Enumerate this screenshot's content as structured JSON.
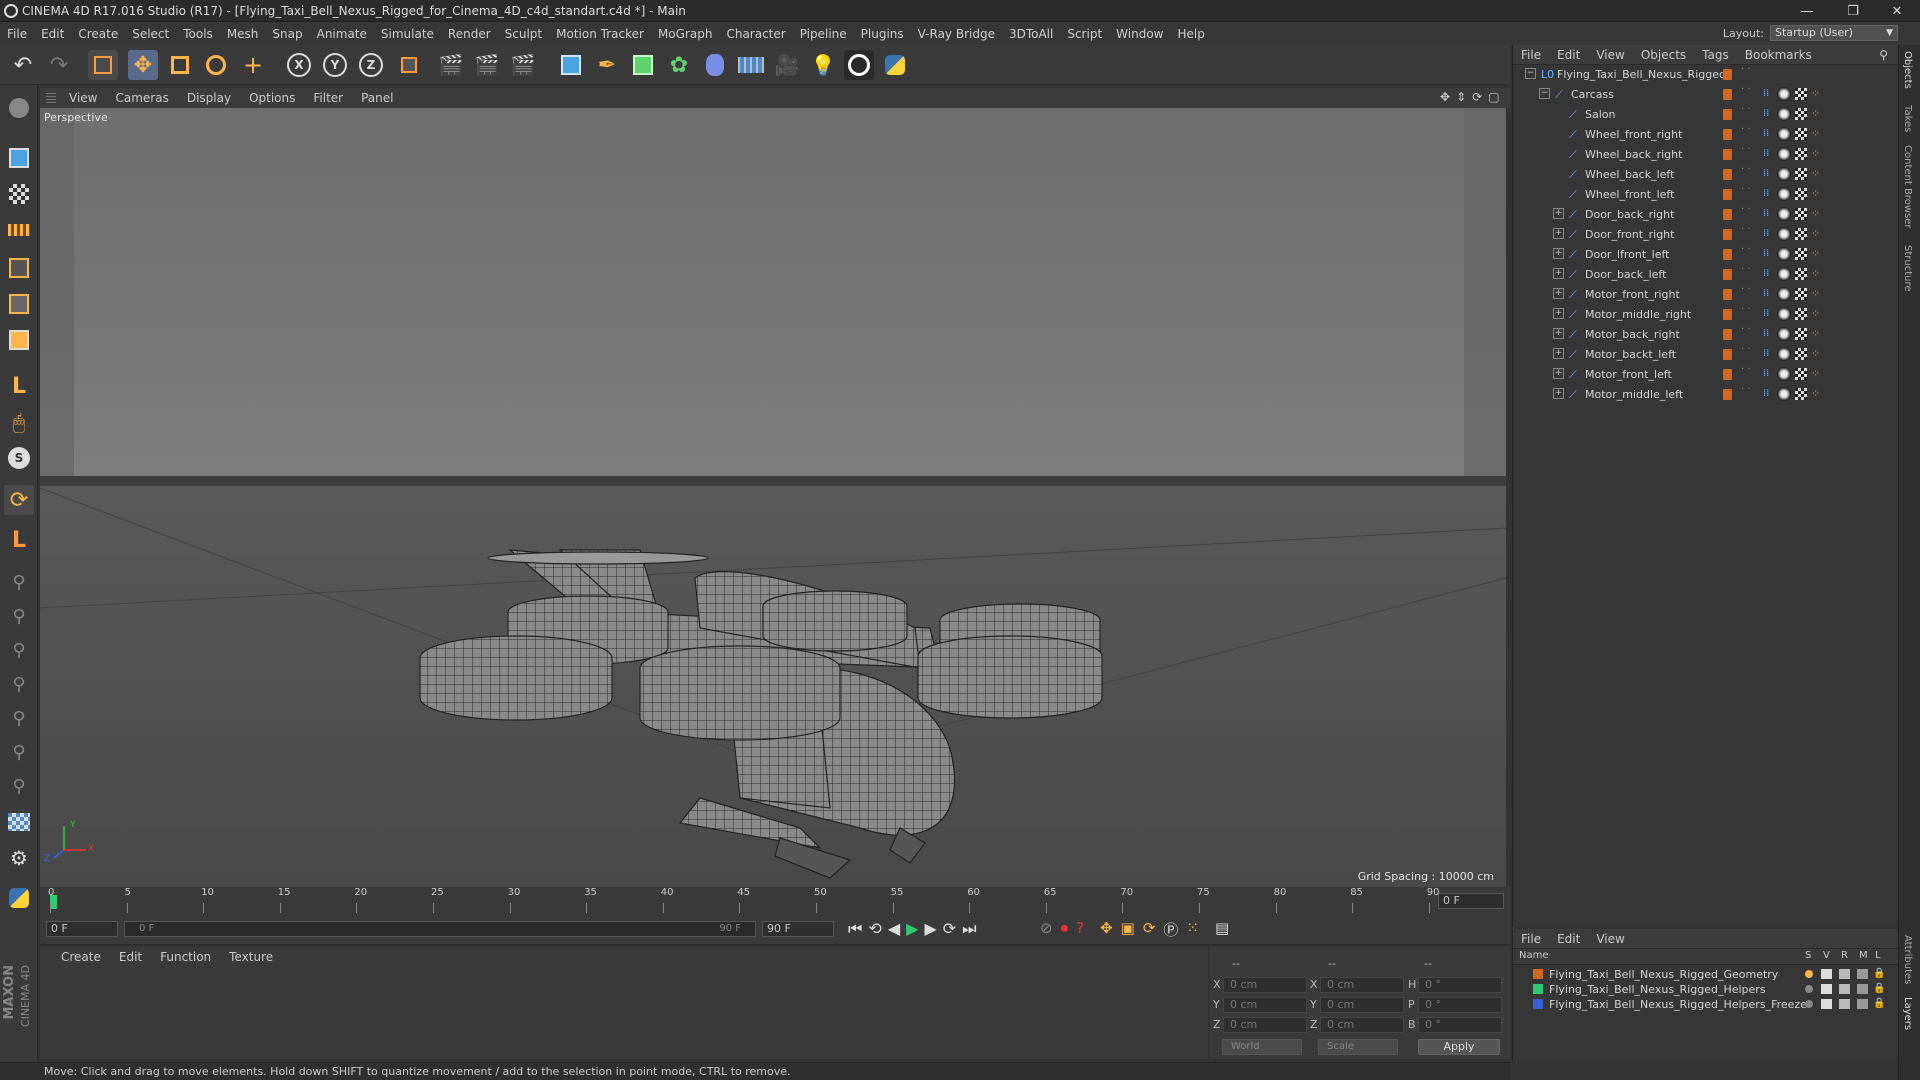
{
  "window": {
    "title": "CINEMA 4D R17.016 Studio (R17) - [Flying_Taxi_Bell_Nexus_Rigged_for_Cinema_4D_c4d_standart.c4d *] - Main",
    "minimize": "—",
    "restore": "❐",
    "close": "✕"
  },
  "menu": [
    "File",
    "Edit",
    "Create",
    "Select",
    "Tools",
    "Mesh",
    "Snap",
    "Animate",
    "Simulate",
    "Render",
    "Sculpt",
    "Motion Tracker",
    "MoGraph",
    "Character",
    "Pipeline",
    "Plugins",
    "V-Ray Bridge",
    "3DToAll",
    "Script",
    "Window",
    "Help"
  ],
  "layout": {
    "label": "Layout:",
    "value": "Startup (User)"
  },
  "viewport": {
    "menu": [
      "View",
      "Cameras",
      "Display",
      "Options",
      "Filter",
      "Panel"
    ],
    "label": "Perspective",
    "grid_spacing": "Grid Spacing : 10000 cm",
    "axis_y": "Y",
    "axis_x": "X",
    "axis_z": "Z"
  },
  "timeline": {
    "ticks": [
      "0",
      "5",
      "10",
      "15",
      "20",
      "25",
      "30",
      "35",
      "40",
      "45",
      "50",
      "55",
      "60",
      "65",
      "70",
      "75",
      "80",
      "85",
      "90"
    ],
    "current_frame": "0 F"
  },
  "transport": {
    "start": "0 F",
    "range_start": "0 F",
    "range_end": "90 F",
    "end": "90 F"
  },
  "material_manager": {
    "menu": [
      "Create",
      "Edit",
      "Function",
      "Texture"
    ]
  },
  "coordinates": {
    "header_a": "--",
    "header_b": "--",
    "header_c": "--",
    "rows": [
      {
        "a": "X",
        "av": "0 cm",
        "b": "X",
        "bv": "0 cm",
        "c": "H",
        "cv": "0 °"
      },
      {
        "a": "Y",
        "av": "0 cm",
        "b": "Y",
        "bv": "0 cm",
        "c": "P",
        "cv": "0 °"
      },
      {
        "a": "Z",
        "av": "0 cm",
        "b": "Z",
        "bv": "0 cm",
        "c": "B",
        "cv": "0 °"
      }
    ],
    "world": "World",
    "scale": "Scale",
    "apply": "Apply"
  },
  "object_manager": {
    "menu": [
      "File",
      "Edit",
      "View",
      "Objects",
      "Tags",
      "Bookmarks"
    ],
    "objects": [
      {
        "name": "Flying_Taxi_Bell_Nexus_Rigged",
        "level": 0,
        "expand": "−"
      },
      {
        "name": "Carcass",
        "level": 1,
        "expand": "−"
      },
      {
        "name": "Salon",
        "level": 2,
        "expand": ""
      },
      {
        "name": "Wheel_front_right",
        "level": 2,
        "expand": ""
      },
      {
        "name": "Wheel_back_right",
        "level": 2,
        "expand": ""
      },
      {
        "name": "Wheel_back_left",
        "level": 2,
        "expand": ""
      },
      {
        "name": "Wheel_front_left",
        "level": 2,
        "expand": ""
      },
      {
        "name": "Door_back_right",
        "level": 2,
        "expand": "+"
      },
      {
        "name": "Door_front_right",
        "level": 2,
        "expand": "+"
      },
      {
        "name": "Door_lfront_left",
        "level": 2,
        "expand": "+"
      },
      {
        "name": "Door_back_left",
        "level": 2,
        "expand": "+"
      },
      {
        "name": "Motor_front_right",
        "level": 2,
        "expand": "+"
      },
      {
        "name": "Motor_middle_right",
        "level": 2,
        "expand": "+"
      },
      {
        "name": "Motor_back_right",
        "level": 2,
        "expand": "+"
      },
      {
        "name": "Motor_backt_left",
        "level": 2,
        "expand": "+"
      },
      {
        "name": "Motor_front_left",
        "level": 2,
        "expand": "+"
      },
      {
        "name": "Motor_middle_left",
        "level": 2,
        "expand": "+"
      }
    ]
  },
  "layers": {
    "menu": [
      "File",
      "Edit",
      "View"
    ],
    "header": {
      "name": "Name",
      "s": "S",
      "v": "V",
      "r": "R",
      "m": "M",
      "l": "L"
    },
    "items": [
      {
        "name": "Flying_Taxi_Bell_Nexus_Rigged_Geometry",
        "color": "#d2691e"
      },
      {
        "name": "Flying_Taxi_Bell_Nexus_Rigged_Helpers",
        "color": "#2ecc71"
      },
      {
        "name": "Flying_Taxi_Bell_Nexus_Rigged_Helpers_Freeze",
        "color": "#3b5fd9"
      }
    ]
  },
  "side_tabs": [
    "Objects",
    "Takes",
    "Content Browser",
    "Structure",
    "Attributes",
    "Layers"
  ],
  "status": "Move: Click and drag to move elements. Hold down SHIFT to quantize movement / add to the selection in point mode, CTRL to remove.",
  "brand": {
    "maxon": "MAXON",
    "product": "CINEMA 4D"
  },
  "colors": {
    "accent": "#d2691e",
    "bg": "#333333",
    "viewport": "#6a6a6a"
  }
}
